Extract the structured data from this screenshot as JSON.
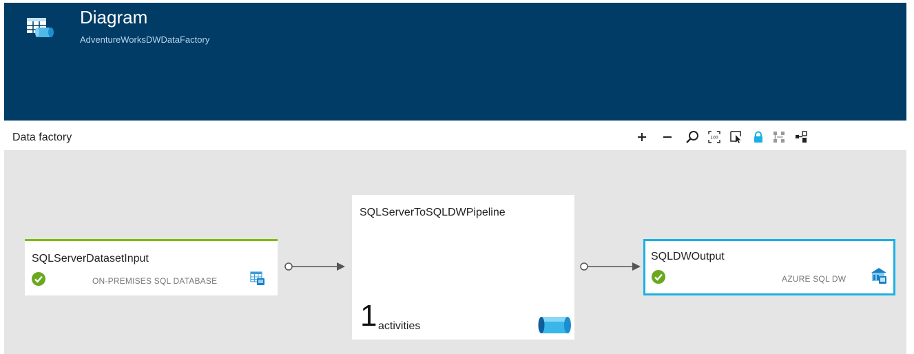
{
  "header": {
    "title": "Diagram",
    "subtitle": "AdventureWorksDWDataFactory",
    "icon": "data-factory-icon"
  },
  "toolbar": {
    "title": "Data factory",
    "tools": [
      {
        "name": "zoom-in",
        "icon": "plus-icon"
      },
      {
        "name": "zoom-out",
        "icon": "minus-icon"
      },
      {
        "name": "zoom-to-fit",
        "icon": "magnifier-icon"
      },
      {
        "name": "zoom-100",
        "icon": "zoom-100-icon"
      },
      {
        "name": "select",
        "icon": "pointer-select-icon"
      },
      {
        "name": "lock",
        "icon": "lock-icon",
        "active": true
      },
      {
        "name": "auto-arrange",
        "icon": "arrange-icon"
      },
      {
        "name": "show-lineage",
        "icon": "lineage-icon"
      }
    ]
  },
  "diagram": {
    "input": {
      "title": "SQLServerDatasetInput",
      "type_label": "ON-PREMISES SQL DATABASE",
      "status": "ready",
      "accent": "#7fba00"
    },
    "pipeline": {
      "title": "SQLServerToSQLDWPipeline",
      "activity_count": "1",
      "activity_label": "activities"
    },
    "output": {
      "title": "SQLDWOutput",
      "type_label": "AZURE SQL DW",
      "status": "ready",
      "accent": "#1ab0e6"
    }
  },
  "colors": {
    "header_bg": "#003c66",
    "canvas_bg": "#e5e5e5",
    "success": "#6aa81e",
    "lock_active": "#1ab0e6"
  }
}
